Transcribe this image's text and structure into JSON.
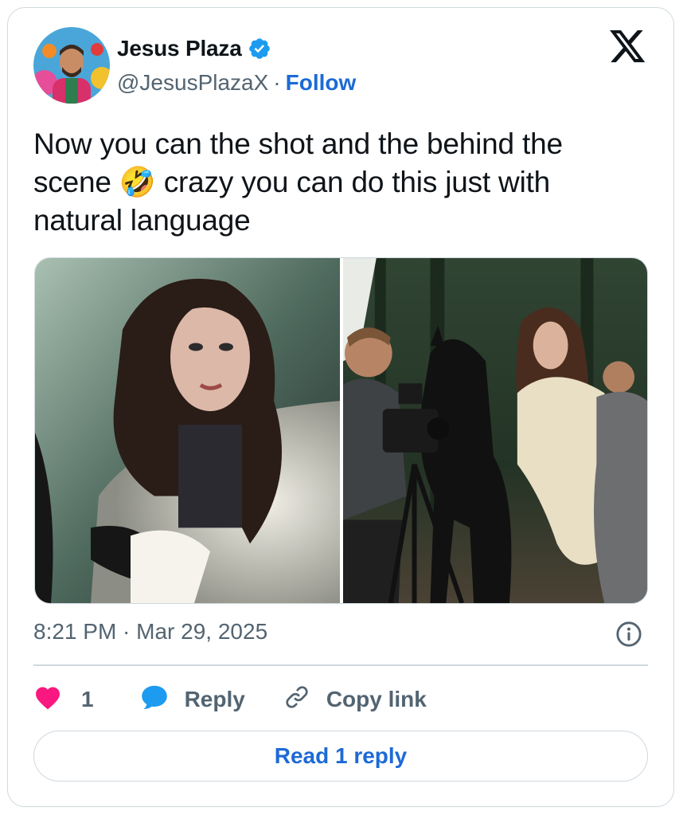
{
  "author": {
    "name": "Jesus Plaza",
    "handle": "@JesusPlazaX",
    "separator": "·",
    "follow_label": "Follow",
    "verified_color": "#1d9bf0"
  },
  "platform_logo": "x-logo",
  "tweet": {
    "text": "Now you can the shot and the behind the scene 🤣 crazy you can do this just with natural language",
    "timestamp": "8:21 PM · Mar 29, 2025"
  },
  "media": [
    {
      "icon": "photo-woman-portrait"
    },
    {
      "icon": "photo-behind-the-scenes"
    }
  ],
  "actions": {
    "like_count": "1",
    "reply_label": "Reply",
    "copy_link_label": "Copy link"
  },
  "read_reply_label": "Read 1 reply",
  "colors": {
    "accent": "#1d6ad6",
    "like": "#f91880",
    "reply_icon": "#1d9bf0",
    "secondary_text": "#536471",
    "border": "#cfd9de"
  }
}
